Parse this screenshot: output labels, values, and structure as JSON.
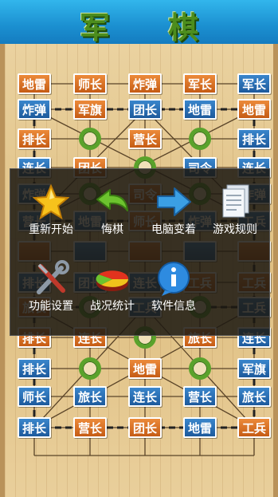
{
  "title": "军 棋",
  "board": {
    "cells": [
      {
        "label": "地雷",
        "color": "orange"
      },
      {
        "label": "师长",
        "color": "orange"
      },
      {
        "label": "炸弹",
        "color": "orange"
      },
      {
        "label": "军长",
        "color": "orange"
      },
      {
        "label": "军长",
        "color": "blue"
      },
      {
        "label": "炸弹",
        "color": "blue"
      },
      {
        "label": "军旗",
        "color": "orange"
      },
      {
        "label": "团长",
        "color": "blue"
      },
      {
        "label": "地雷",
        "color": "blue"
      },
      {
        "label": "地雷",
        "color": "orange"
      },
      {
        "label": "排长",
        "color": "orange"
      },
      null,
      {
        "label": "营长",
        "color": "orange"
      },
      null,
      {
        "label": "排长",
        "color": "blue"
      },
      {
        "label": "连长",
        "color": "blue"
      },
      {
        "label": "团长",
        "color": "orange"
      },
      null,
      {
        "label": "司令",
        "color": "blue"
      },
      {
        "label": "连长",
        "color": "blue"
      },
      {
        "label": "炸弹",
        "color": "blue"
      },
      null,
      {
        "label": "司令",
        "color": "orange"
      },
      null,
      {
        "label": "炸弹",
        "color": "blue"
      },
      {
        "label": "营长",
        "color": "blue"
      },
      {
        "label": "地雷",
        "color": "blue"
      },
      {
        "label": "师长",
        "color": "orange"
      },
      {
        "label": "炸弹",
        "color": "blue"
      },
      {
        "label": "工兵",
        "color": "blue"
      },
      {
        "label": "",
        "color": "orange"
      },
      {
        "label": "",
        "color": "blue"
      },
      {
        "label": "",
        "color": "orange"
      },
      {
        "label": "",
        "color": "blue"
      },
      {
        "label": "",
        "color": "orange"
      },
      {
        "label": "排长",
        "color": "blue"
      },
      {
        "label": "团长",
        "color": "blue"
      },
      {
        "label": "连长",
        "color": "blue"
      },
      {
        "label": "工兵",
        "color": "orange"
      },
      {
        "label": "工兵",
        "color": "orange"
      },
      {
        "label": "旅长",
        "color": "orange"
      },
      null,
      {
        "label": "工兵",
        "color": "blue"
      },
      null,
      {
        "label": "工兵",
        "color": "blue"
      },
      {
        "label": "排长",
        "color": "orange"
      },
      {
        "label": "连长",
        "color": "orange"
      },
      null,
      {
        "label": "旅长",
        "color": "orange"
      },
      {
        "label": "连长",
        "color": "blue"
      },
      {
        "label": "排长",
        "color": "blue"
      },
      null,
      {
        "label": "地雷",
        "color": "orange"
      },
      null,
      {
        "label": "军旗",
        "color": "blue"
      },
      {
        "label": "师长",
        "color": "blue"
      },
      {
        "label": "旅长",
        "color": "blue"
      },
      {
        "label": "连长",
        "color": "blue"
      },
      {
        "label": "营长",
        "color": "blue"
      },
      {
        "label": "旅长",
        "color": "blue"
      },
      {
        "label": "排长",
        "color": "blue"
      },
      {
        "label": "营长",
        "color": "orange"
      },
      {
        "label": "团长",
        "color": "orange"
      },
      {
        "label": "地雷",
        "color": "blue"
      },
      {
        "label": "工兵",
        "color": "orange"
      }
    ]
  },
  "menu": {
    "items": [
      {
        "label": "重新开始",
        "icon": "star-icon"
      },
      {
        "label": "悔棋",
        "icon": "undo-arrow-icon"
      },
      {
        "label": "电脑变着",
        "icon": "forward-arrow-icon"
      },
      {
        "label": "游戏规则",
        "icon": "document-icon"
      },
      {
        "label": "功能设置",
        "icon": "tools-icon"
      },
      {
        "label": "战况统计",
        "icon": "pie-chart-icon"
      },
      {
        "label": "软件信息",
        "icon": "info-icon"
      }
    ]
  }
}
